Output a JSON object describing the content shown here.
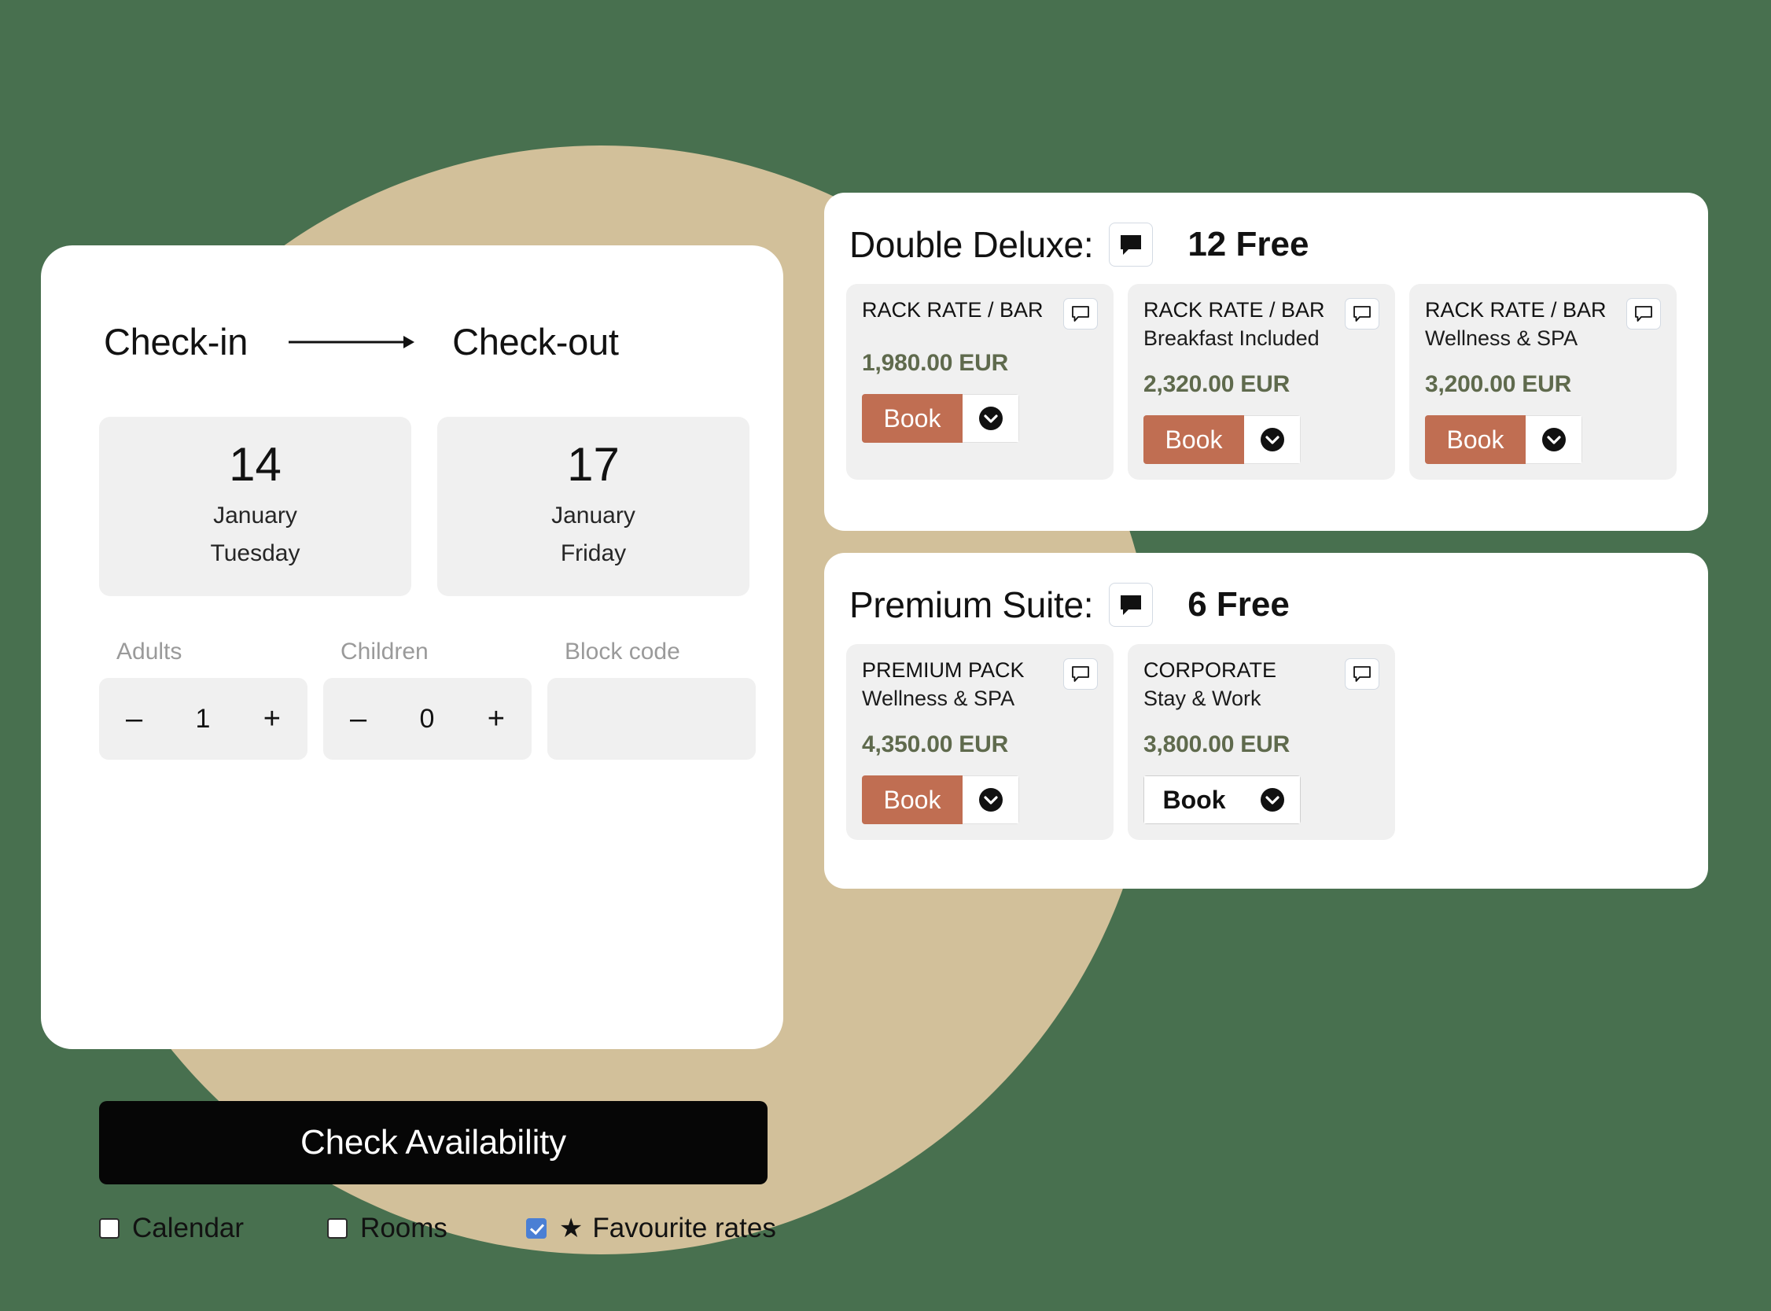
{
  "theme": {
    "background_color": "#48704F",
    "circle_color": "#D2C09A",
    "accent_color": "#C06E52",
    "price_color": "#5F6A4D",
    "cta_color": "#060606",
    "checkbox_checked_color": "#4A7FD4"
  },
  "search": {
    "checkin_label": "Check-in",
    "checkout_label": "Check-out",
    "arrow_icon": "arrow-right-icon",
    "checkin": {
      "day": "14",
      "month": "January",
      "weekday": "Tuesday"
    },
    "checkout": {
      "day": "17",
      "month": "January",
      "weekday": "Friday"
    },
    "adults": {
      "label": "Adults",
      "value": "1",
      "minus": "–",
      "plus": "+"
    },
    "children": {
      "label": "Children",
      "value": "0",
      "minus": "–",
      "plus": "+"
    },
    "block_code": {
      "label": "Block code",
      "value": "",
      "placeholder": ""
    },
    "submit_label": "Check Availability",
    "options": [
      {
        "label": "Calendar",
        "checked": false,
        "star": false
      },
      {
        "label": "Rooms",
        "checked": false,
        "star": false
      },
      {
        "label": "Favourite rates",
        "checked": true,
        "star": true,
        "star_glyph": "★"
      }
    ]
  },
  "room_panels": [
    {
      "title": "Double Deluxe:",
      "note_icon": "comment-filled-icon",
      "availability": "12 Free",
      "rates": [
        {
          "name": "RACK RATE / BAR",
          "subtitle": "",
          "note_icon": "comment-outline-icon",
          "price": "1,980.00 EUR",
          "book_label": "Book",
          "book_style": "filled",
          "caret_icon": "chevron-down-circle-icon"
        },
        {
          "name": "RACK RATE / BAR",
          "subtitle": "Breakfast Included",
          "note_icon": "comment-outline-icon",
          "price": "2,320.00 EUR",
          "book_label": "Book",
          "book_style": "filled",
          "caret_icon": "chevron-down-circle-icon"
        },
        {
          "name": "RACK RATE / BAR",
          "subtitle": "Wellness & SPA",
          "note_icon": "comment-outline-icon",
          "price": "3,200.00 EUR",
          "book_label": "Book",
          "book_style": "filled",
          "caret_icon": "chevron-down-circle-icon"
        }
      ]
    },
    {
      "title": "Premium Suite:",
      "note_icon": "comment-filled-icon",
      "availability": "6 Free",
      "rates": [
        {
          "name": "PREMIUM PACK",
          "subtitle": "Wellness & SPA",
          "note_icon": "comment-outline-icon",
          "price": "4,350.00 EUR",
          "book_label": "Book",
          "book_style": "filled",
          "caret_icon": "chevron-down-circle-icon"
        },
        {
          "name": "CORPORATE",
          "subtitle": "Stay & Work",
          "note_icon": "comment-outline-icon",
          "price": "3,800.00 EUR",
          "book_label": "Book",
          "book_style": "outline",
          "caret_icon": "chevron-down-circle-icon"
        }
      ]
    }
  ]
}
